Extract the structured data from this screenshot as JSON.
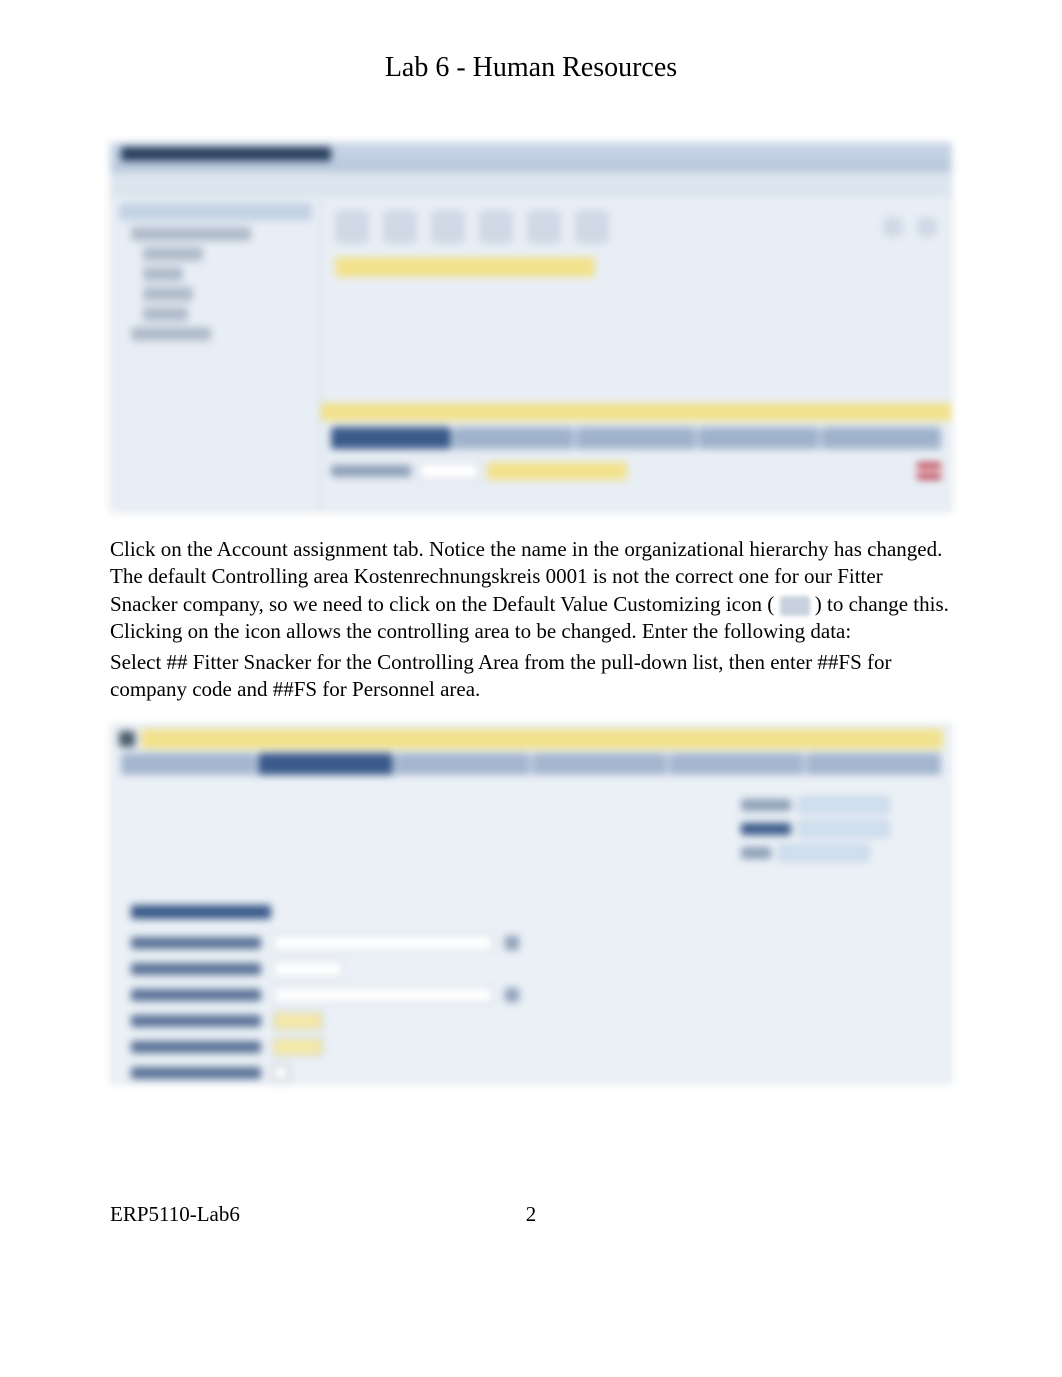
{
  "title": "Lab 6 - Human Resources",
  "screenshot1": {
    "window_title": "Organization and Staffing Create",
    "left_panel_header": "Find by",
    "tree_items": [
      "Organizational unit",
      "Position",
      "Job",
      "Person",
      "User",
      "Task"
    ],
    "highlight_text": "Organizational unit",
    "panel_header": "Details for Organizational unit New org unit",
    "tabs": [
      "Basic data",
      "Account assignment",
      "Cost",
      "Address",
      "Work schedule"
    ],
    "active_tab": "Basic data",
    "field_label": "Organizational unit",
    "field_value": "New",
    "field_value2": "New org unit"
  },
  "paragraph1": {
    "p1": "Click on the Account assignment   tab. Notice the name in the organizational hierarchy has changed. The default Controlling area Kostenrechnungskreis 0001 is not the correct one for our Fitter Snacker company, so we need to click on the Default Value Customizing icon (",
    "p2": ") to change this.  Clicking on the icon allows the controlling area to be changed.  Enter the following data:"
  },
  "paragraph2": "Select ## Fitter Snacker   for the Controlling Area from the pull-down list, then enter ##FS for company code and ##FS for Personnel area.",
  "screenshot2": {
    "title": "Details for Organizational unit ## Fitter Snacker Headquarters",
    "tabs": [
      "Basic data",
      "Account assignment",
      "Address",
      "Cost distribution",
      "Work schedule",
      "Quota Planning"
    ],
    "active_tab": "Account assignment",
    "date_labels": [
      "Valid from",
      "Valid to"
    ],
    "date_values": [
      "01/01/2009",
      "12/31/9999"
    ],
    "section_label": "Account assignment",
    "form_rows": [
      {
        "label": "Controlling Area",
        "value": "## Fitter Snacker",
        "type": "dropdown"
      },
      {
        "label": "Master cost center",
        "value": "",
        "type": "input"
      },
      {
        "label": "Business area",
        "value": "",
        "type": "dropdown"
      },
      {
        "label": "Company Code",
        "value": "##FS",
        "type": "short"
      },
      {
        "label": "Personnel area",
        "value": "##FS",
        "type": "short"
      },
      {
        "label": "Pers. subarea",
        "value": "",
        "type": "checkbox"
      }
    ]
  },
  "footer": {
    "left": "ERP5110-Lab6",
    "page": "2"
  }
}
